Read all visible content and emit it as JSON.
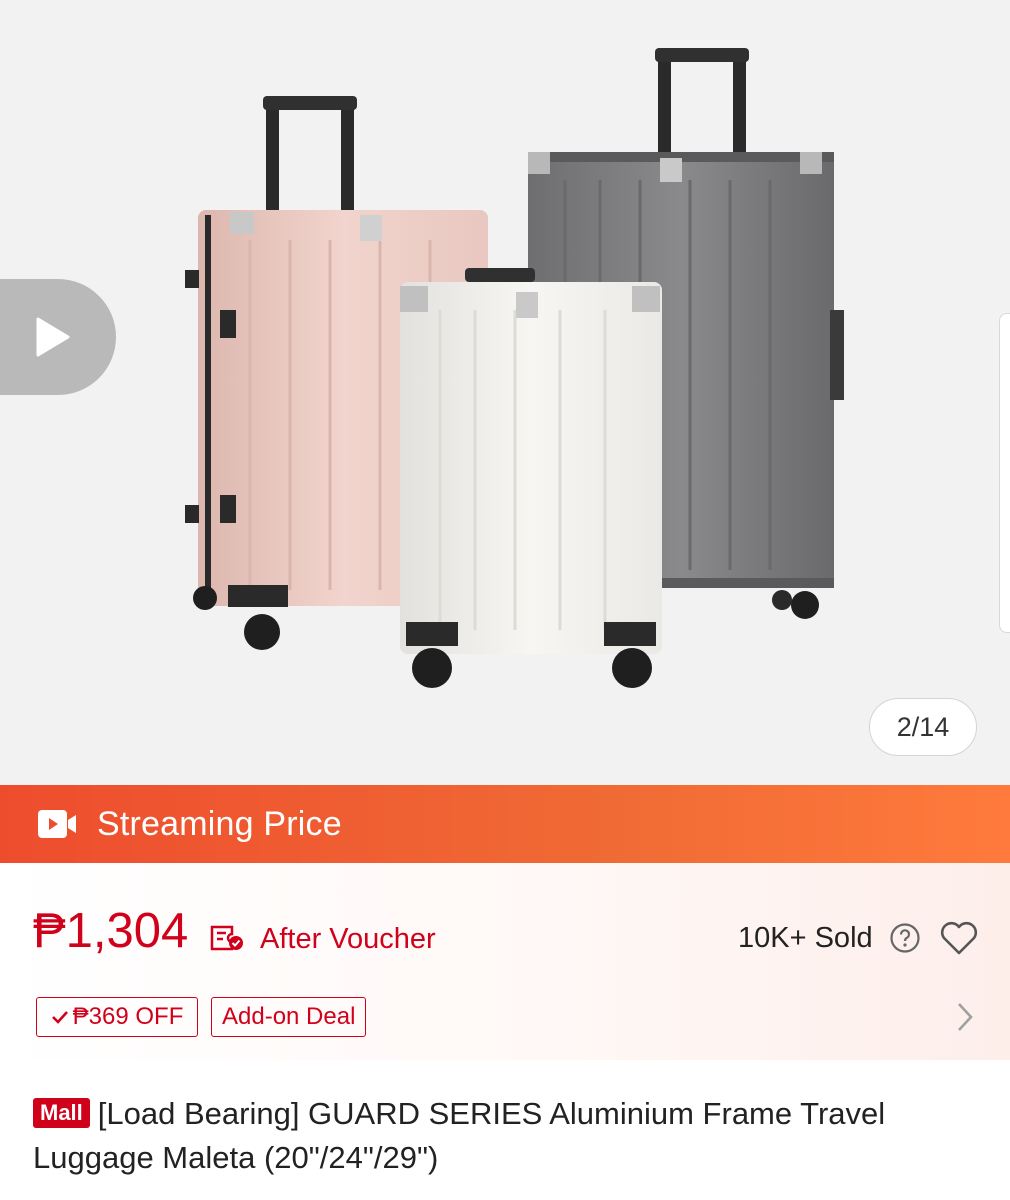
{
  "gallery": {
    "counter": "2/14",
    "images": [
      {
        "label": "pink suitcase",
        "color": "#edcfc8"
      },
      {
        "label": "grey suitcase",
        "color": "#7c7c7e"
      },
      {
        "label": "white suitcase",
        "color": "#f1efec"
      }
    ],
    "play_icon": "play-icon"
  },
  "stream_bar": {
    "label": "Streaming Price",
    "icon": "video-camera-icon",
    "color": "#ee4d2d"
  },
  "price": {
    "amount": "₱1,304",
    "voucher_icon": "voucher-ticket-icon",
    "note": "After Voucher",
    "sold": "10K+ Sold",
    "help_icon": "question-circle-icon",
    "favorite_icon": "heart-outline-icon",
    "accent": "#d0011b"
  },
  "tags": {
    "discount": "₱369 OFF",
    "addon": "Add-on Deal",
    "more_icon": "chevron-right-icon"
  },
  "product": {
    "badge": "Mall",
    "title": "[Load Bearing] GUARD SERIES Aluminium Frame Travel Luggage Maleta (20\"/24\"/29\")"
  }
}
